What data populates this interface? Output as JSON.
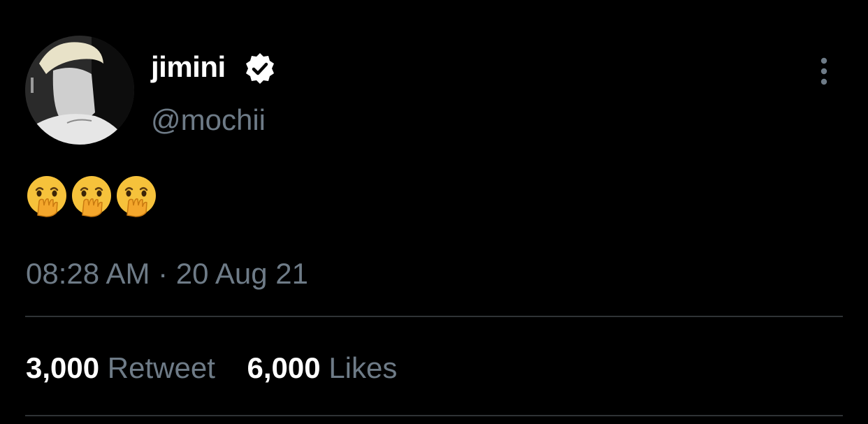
{
  "tweet": {
    "author": {
      "display_name": "jimini",
      "handle": "@mochii",
      "verified": true,
      "avatar_icon": "profile-photo"
    },
    "body_emojis": [
      "face-with-hand-over-mouth",
      "face-with-hand-over-mouth",
      "face-with-hand-over-mouth"
    ],
    "timestamp": "08:28 AM · 20 Aug 21",
    "stats": {
      "retweets_count": "3,000",
      "retweets_label": "Retweet",
      "likes_count": "6,000",
      "likes_label": "Likes"
    },
    "menu_icon": "more-vertical-icon"
  },
  "colors": {
    "background": "#000000",
    "primary_text": "#ffffff",
    "secondary_text": "#6e7b87",
    "divider": "#2f3336"
  }
}
